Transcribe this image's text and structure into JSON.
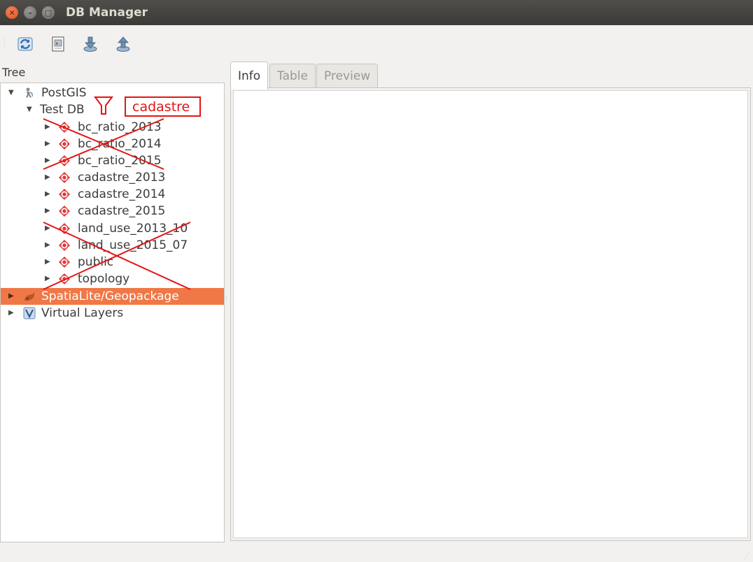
{
  "window": {
    "title": "DB Manager"
  },
  "toolbar": {
    "buttons": [
      {
        "icon": "refresh-icon"
      },
      {
        "icon": "sql-window-icon"
      },
      {
        "icon": "import-layer-icon"
      },
      {
        "icon": "export-icon"
      }
    ]
  },
  "tree": {
    "label": "Tree",
    "filter_text": "cadastre",
    "items": [
      {
        "label": "PostGIS",
        "expanded": true,
        "icon": "postgis-icon"
      },
      {
        "label": "Test DB",
        "expanded": true
      },
      {
        "label": "bc_ratio_2013",
        "icon": "schema-icon"
      },
      {
        "label": "bc_ratio_2014",
        "icon": "schema-icon"
      },
      {
        "label": "bc_ratio_2015",
        "icon": "schema-icon"
      },
      {
        "label": "cadastre_2013",
        "icon": "schema-icon"
      },
      {
        "label": "cadastre_2014",
        "icon": "schema-icon"
      },
      {
        "label": "cadastre_2015",
        "icon": "schema-icon"
      },
      {
        "label": "land_use_2013_10",
        "icon": "schema-icon"
      },
      {
        "label": "land_use_2015_07",
        "icon": "schema-icon"
      },
      {
        "label": "public",
        "icon": "schema-icon"
      },
      {
        "label": "topology",
        "icon": "schema-icon"
      },
      {
        "label": "SpatiaLite/Geopackage",
        "selected": true,
        "icon": "spatialite-icon"
      },
      {
        "label": "Virtual Layers",
        "icon": "virtual-layers-icon"
      }
    ]
  },
  "tabs": [
    {
      "label": "Info",
      "active": true
    },
    {
      "label": "Table",
      "active": false
    },
    {
      "label": "Preview",
      "active": false
    }
  ],
  "colors": {
    "selection": "#f07746",
    "annotation": "#e21616",
    "schema_icon": "#e03a3a"
  }
}
